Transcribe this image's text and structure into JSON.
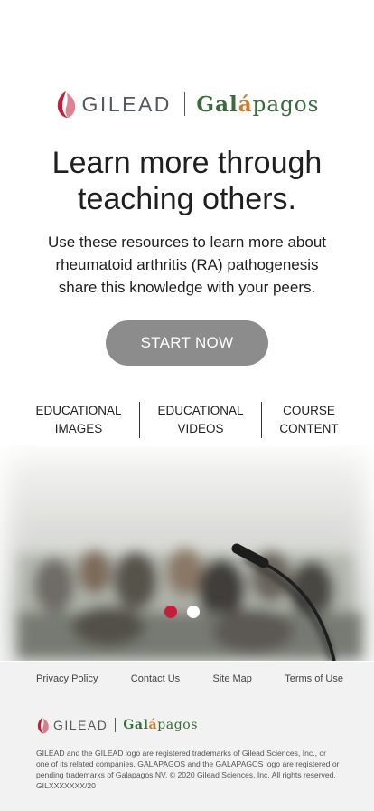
{
  "header": {
    "gilead_logo_text": "GILEAD",
    "galapagos_logo": {
      "part1": "Gal",
      "part2": "á",
      "part3": "pagos"
    }
  },
  "hero_copy": {
    "headline_line1": "Learn more through",
    "headline_line2": "teaching others.",
    "subcopy": "Use these resources to learn more about rheumatoid arthritis (RA) pathogenesis share this knowledge with your peers."
  },
  "cta": {
    "label": "START NOW"
  },
  "nav": [
    {
      "line1": "EDUCATIONAL",
      "line2": "IMAGES"
    },
    {
      "line1": "EDUCATIONAL",
      "line2": "VIDEOS"
    },
    {
      "line1": "COURSE",
      "line2": "CONTENT"
    }
  ],
  "carousel": {
    "slide_count": 2,
    "active_index": 0
  },
  "footer": {
    "links": [
      "Privacy Policy",
      "Contact Us",
      "Site Map",
      "Terms of Use"
    ],
    "legal": "GILEAD and the GILEAD logo are registered trademarks of Gilead Sciences, Inc., or one of its related companies. GALAPAGOS and the GALAPAGOS logo are registered or pending trademarks of Galapagos NV. © 2020 Gilead Sciences, Inc. All rights reserved. GILXXXXXXX/20"
  },
  "colors": {
    "gilead_red": "#c41e3a",
    "galapagos_green": "#3a6b3a",
    "galapagos_orange": "#d17a2a",
    "button_gray": "#8c8c8c",
    "footer_bg": "#f2f2f2"
  }
}
